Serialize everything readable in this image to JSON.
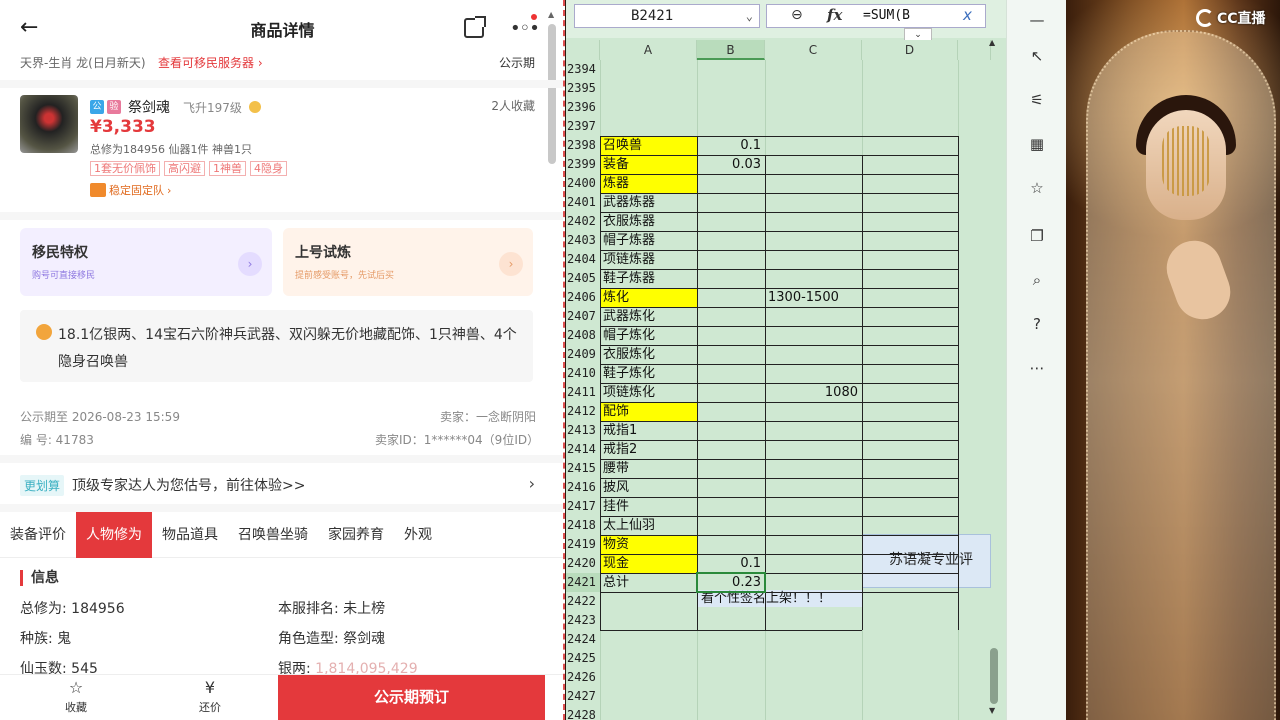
{
  "phone": {
    "title": "商品详情",
    "server": "天界-生肖 龙(日月新天)",
    "server_link": "查看可移民服务器",
    "server_arrow": "›",
    "publicity": "公示期",
    "product": {
      "tag1": "公",
      "tag2": "验",
      "name": "祭剑魂",
      "level": "飞升197级",
      "favorites": "2人收藏",
      "price": "¥3,333",
      "stats": "总修为184956  仙器1件  神兽1只",
      "chips": [
        "1套无价佩饰",
        "高闪避",
        "1神兽",
        "4隐身"
      ],
      "team": "稳定固定队",
      "team_arrow": "›"
    },
    "cards": [
      {
        "title": "移民特权",
        "sub": "购号可直接移民",
        "arrow": "›"
      },
      {
        "title": "上号试炼",
        "sub": "提前感受账号，先试后买",
        "arrow": "›"
      }
    ],
    "description": "18.1亿银两、14宝石六阶神兵武器、双闪躲无价地藏配饰、1只神兽、4个隐身召唤兽",
    "pub_until": "公示期至 2026-08-23 15:59",
    "seller": "卖家：一念断阴阳",
    "number": "编 号: 41783",
    "seller_id": "卖家ID：1******04（9位ID）",
    "expert_badge": "更划算",
    "expert_text": "顶级专家达人为您估号，前往体验>>",
    "expert_arrow": "›",
    "tabs": [
      "装备评价",
      "人物修为",
      "物品道具",
      "召唤兽坐骑",
      "家园养育",
      "外观"
    ],
    "info_title": "信息",
    "info": [
      {
        "k": "总修为:",
        "v": "184956"
      },
      {
        "k": "本服排名:",
        "v": "未上榜"
      },
      {
        "k": "种族:",
        "v": "鬼"
      },
      {
        "k": "角色造型:",
        "v": "祭剑魂"
      },
      {
        "k": "仙玉数:",
        "v": "545"
      },
      {
        "k": "银两:",
        "v": "1,814,095,429"
      }
    ],
    "bottom": {
      "fav": "收藏",
      "fav_icon": "☆",
      "bargain": "还价",
      "bargain_icon": "¥",
      "buy": "公示期预订"
    }
  },
  "sheet": {
    "namebox": "B2421",
    "namebox_arrow": "⌄",
    "zoom_icon": "⊖",
    "fx": "fx",
    "formula": "=SUM(B",
    "formula_x": "x",
    "chevron": "⌄",
    "columns": [
      "A",
      "B",
      "C",
      "D"
    ],
    "selected_col": "B",
    "rows": [
      {
        "n": "2394",
        "a": "",
        "b": "",
        "c": "",
        "ya": false
      },
      {
        "n": "2395",
        "a": "",
        "b": "",
        "c": "",
        "ya": false
      },
      {
        "n": "2396",
        "a": "",
        "b": "",
        "c": "",
        "ya": false
      },
      {
        "n": "2397",
        "a": "",
        "b": "",
        "c": "",
        "ya": false
      },
      {
        "n": "2398",
        "a": "召唤兽",
        "b": "0.1",
        "c": "",
        "ya": true
      },
      {
        "n": "2399",
        "a": "装备",
        "b": "0.03",
        "c": "",
        "ya": true
      },
      {
        "n": "2400",
        "a": "炼器",
        "b": "",
        "c": "",
        "ya": true
      },
      {
        "n": "2401",
        "a": "武器炼器",
        "b": "",
        "c": "",
        "ya": false
      },
      {
        "n": "2402",
        "a": "衣服炼器",
        "b": "",
        "c": "",
        "ya": false
      },
      {
        "n": "2403",
        "a": "帽子炼器",
        "b": "",
        "c": "",
        "ya": false
      },
      {
        "n": "2404",
        "a": "项链炼器",
        "b": "",
        "c": "",
        "ya": false
      },
      {
        "n": "2405",
        "a": "鞋子炼器",
        "b": "",
        "c": "",
        "ya": false
      },
      {
        "n": "2406",
        "a": "炼化",
        "b": "",
        "c": "1300-1500",
        "ya": true
      },
      {
        "n": "2407",
        "a": "武器炼化",
        "b": "",
        "c": "",
        "ya": false
      },
      {
        "n": "2408",
        "a": "帽子炼化",
        "b": "",
        "c": "",
        "ya": false
      },
      {
        "n": "2409",
        "a": "衣服炼化",
        "b": "",
        "c": "",
        "ya": false
      },
      {
        "n": "2410",
        "a": "鞋子炼化",
        "b": "",
        "c": "",
        "ya": false
      },
      {
        "n": "2411",
        "a": "项链炼化",
        "b": "",
        "c": "1080",
        "ya": false
      },
      {
        "n": "2412",
        "a": "配饰",
        "b": "",
        "c": "",
        "ya": true
      },
      {
        "n": "2413",
        "a": "戒指1",
        "b": "",
        "c": "",
        "ya": false
      },
      {
        "n": "2414",
        "a": "戒指2",
        "b": "",
        "c": "",
        "ya": false
      },
      {
        "n": "2415",
        "a": "腰带",
        "b": "",
        "c": "",
        "ya": false
      },
      {
        "n": "2416",
        "a": "披风",
        "b": "",
        "c": "",
        "ya": false
      },
      {
        "n": "2417",
        "a": "挂件",
        "b": "",
        "c": "",
        "ya": false
      },
      {
        "n": "2418",
        "a": "太上仙羽",
        "b": "",
        "c": "",
        "ya": false
      },
      {
        "n": "2419",
        "a": "物资",
        "b": "",
        "c": "",
        "ya": true
      },
      {
        "n": "2420",
        "a": "现金",
        "b": "0.1",
        "c": "",
        "ya": true
      },
      {
        "n": "2421",
        "a": "总计",
        "b": "0.23",
        "c": "",
        "ya": false
      },
      {
        "n": "2422",
        "a": "",
        "b": "",
        "c": "",
        "ya": false
      },
      {
        "n": "2423",
        "a": "",
        "b": "",
        "c": "",
        "ya": false
      },
      {
        "n": "2424",
        "a": "",
        "b": "",
        "c": "",
        "ya": false
      },
      {
        "n": "2425",
        "a": "",
        "b": "",
        "c": "",
        "ya": false
      },
      {
        "n": "2426",
        "a": "",
        "b": "",
        "c": "",
        "ya": false
      },
      {
        "n": "2427",
        "a": "",
        "b": "",
        "c": "",
        "ya": false
      },
      {
        "n": "2428",
        "a": "",
        "b": "",
        "c": "",
        "ya": false
      },
      {
        "n": "2429",
        "a": "",
        "b": "",
        "c": "",
        "ya": false
      }
    ],
    "note": "苏语凝专业评",
    "signature": "看个性签名上架！！！"
  },
  "toolbar": {
    "icons": [
      "minimize-icon",
      "cursor-icon",
      "sliders-icon",
      "layout-icon",
      "star-icon",
      "copy-icon",
      "search-doc-icon",
      "help-icon",
      "more-icon"
    ],
    "glyphs": [
      "—",
      "↖",
      "⚟",
      "▦",
      "☆",
      "❐",
      "⌕",
      "?",
      "⋯"
    ]
  },
  "watermark": "CC直播"
}
